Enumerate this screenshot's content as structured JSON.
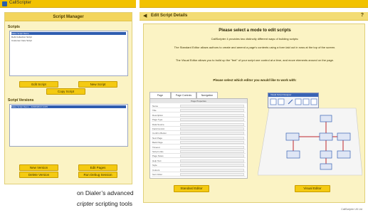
{
  "app": {
    "title": "CallScripter"
  },
  "script_manager": {
    "title": "Script Manager",
    "scripts_label": "Scripts",
    "scripts": [
      {
        "name": "Sales Script Demo",
        "selected": true
      },
      {
        "name": "Debt Collection Script"
      },
      {
        "name": "Customer Care Script"
      }
    ],
    "edit_script": "Edit Script",
    "new_script": "New Script",
    "copy_script": "Copy Script",
    "versions_label": "Script Versions",
    "versions": [
      {
        "name": "Sales Script Demo - 22/06/2010 14:05",
        "selected": true
      }
    ],
    "new_version": "New Version",
    "edit_pages": "Edit Pages",
    "delete_version": "Delete Version",
    "run_debug": "Run Debug Session"
  },
  "caption": {
    "line1": "on Dialer’s advanced",
    "line2_italic": "cripter",
    "line2_rest": " scripting tools"
  },
  "editor": {
    "back_icon": "left-arrow-icon",
    "header_title": "Edit Script Details",
    "help": "?",
    "heading": "Please select a mode to edit scripts",
    "intro1": "CallScripter 4 provides two distinctly different ways of building scripts:",
    "intro2": "The Standard Editor allows authors to create and amend a page's contents using a form laid out in rows at the top of the screen.",
    "intro3": "The Visual Editor allows you to build up the \"feel\" of your script one control at a time, and move elements around on the page.",
    "question": "Please select which editor you would like to work with:",
    "standard_button": "Standard Editor",
    "visual_button": "Visual Editor",
    "standard_preview": {
      "tabs": [
        "Page",
        "Page Controls",
        "Navigation"
      ],
      "box_title": "Page Properties",
      "rows": [
        "Name",
        "Title",
        "Description",
        "Page Type",
        "Data Source",
        "Field Control",
        "Confirm Button",
        "Next Page",
        "Back Page",
        "Timeout",
        "Script Links",
        "Page Notes",
        "Help Text",
        "Style",
        "Colours",
        "Sort Order"
      ]
    },
    "visual_preview": {
      "palette_title": "Visual Script Designer"
    }
  },
  "footer": "CallScripter UK Ltd"
}
